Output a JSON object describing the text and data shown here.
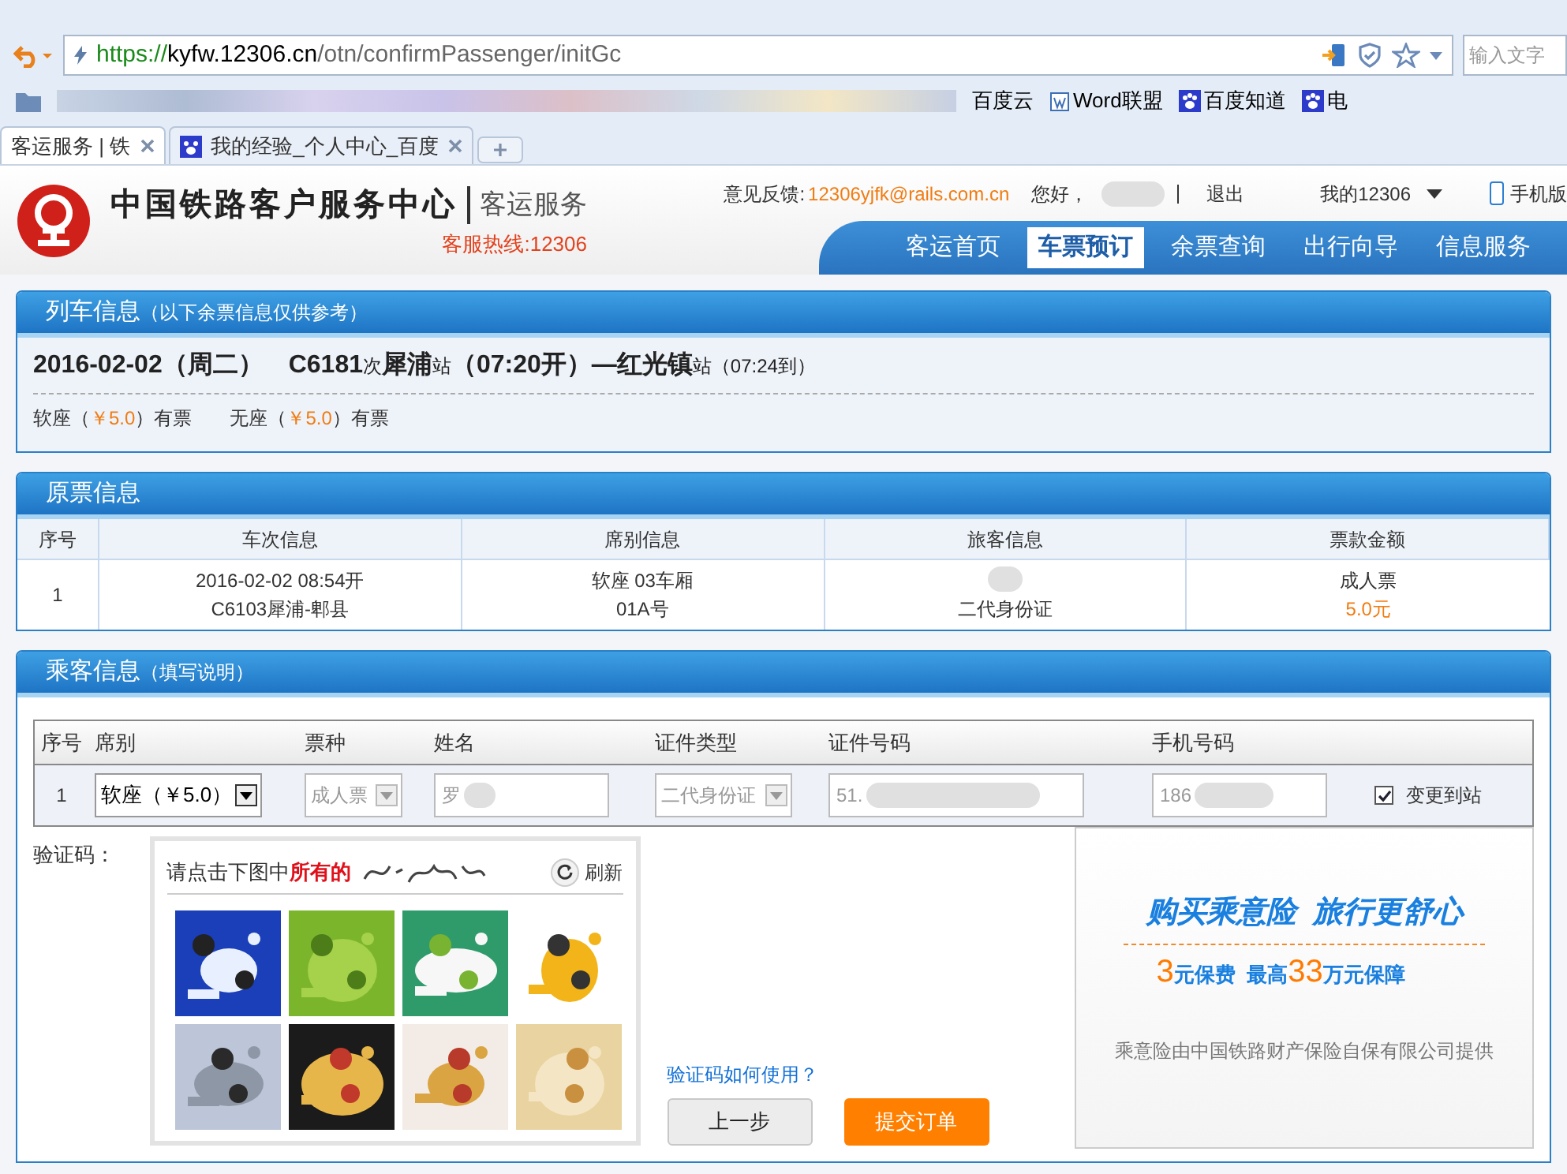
{
  "browser": {
    "url": {
      "scheme": "https://",
      "host": "kyfw.12306.cn",
      "path": "/otn/confirmPassenger/initGc"
    },
    "search": {
      "placeholder": "输入文字"
    },
    "bookmarks": [
      {
        "label": "百度云",
        "kind": "plain"
      },
      {
        "label": "Word联盟",
        "kind": "word"
      },
      {
        "label": "百度知道",
        "kind": "paw"
      },
      {
        "label": "电",
        "kind": "paw"
      }
    ],
    "tabs": [
      {
        "label": "客运服务 | 铁",
        "selected": true
      },
      {
        "label": "我的经验_个人中心_百度",
        "selected": false
      }
    ]
  },
  "site_header": {
    "title": "中国铁路客户服务中心",
    "subtitle": "客运服务",
    "hotline": "客服热线:12306",
    "feedback_label": "意见反馈:",
    "feedback_email": "12306yjfk@rails.com.cn",
    "greeting": "您好，",
    "logout": "退出",
    "my_account": "我的12306",
    "mobile": "手机版",
    "nav": [
      {
        "label": "客运首页",
        "selected": false
      },
      {
        "label": "车票预订",
        "selected": true
      },
      {
        "label": "余票查询",
        "selected": false
      },
      {
        "label": "出行向导",
        "selected": false
      },
      {
        "label": "信息服务",
        "selected": false
      }
    ]
  },
  "train_info": {
    "title": "列车信息",
    "note": "（以下余票信息仅供参考）",
    "summary": "**2016-02-02（周二）　C6181**次 **犀浦**站**（07:20开）—红光镇**站（07:24到）",
    "seats": [
      {
        "label": "软座（",
        "price": "￥5.0",
        "suffix": "）有票"
      },
      {
        "label": "无座（",
        "price": "￥5.0",
        "suffix": "）有票"
      }
    ]
  },
  "original_ticket": {
    "title": "原票信息",
    "columns": [
      "序号",
      "车次信息",
      "席别信息",
      "旅客信息",
      "票款金额"
    ],
    "row": {
      "index": "1",
      "train": [
        "2016-02-02 08:54开",
        "C6103犀浦-郫县"
      ],
      "seat": [
        "软座 03车厢",
        "01A号"
      ],
      "passenger": "二代身份证",
      "ticket": "成人票",
      "amount": "5.0元"
    }
  },
  "passenger_info": {
    "title": "乘客信息",
    "note": "（填写说明）",
    "columns": [
      "序号",
      "席别",
      "票种",
      "姓名",
      "证件类型",
      "证件号码",
      "手机号码"
    ],
    "row": {
      "index": "1",
      "seat": "软座（￥5.0）",
      "ticket_type": "成人票",
      "name": "罗",
      "id_type": "二代身份证",
      "id_number": "51.",
      "phone": "186",
      "change_station": {
        "label": "变更到站",
        "checked": true
      }
    }
  },
  "captcha": {
    "label": "验证码：",
    "prompt": "请点击下图中**所有的**",
    "refresh": "刷新",
    "help": "验证码如何使用？"
  },
  "buttons": {
    "back": "上一步",
    "submit": "提交订单"
  },
  "insurance_ad": {
    "headline": "购买乘意险  旅行更舒心",
    "offer": "**3**元保费  最高**33**万元保障",
    "provider": "乘意险由中国铁路财产保险自保有限公司提供"
  }
}
